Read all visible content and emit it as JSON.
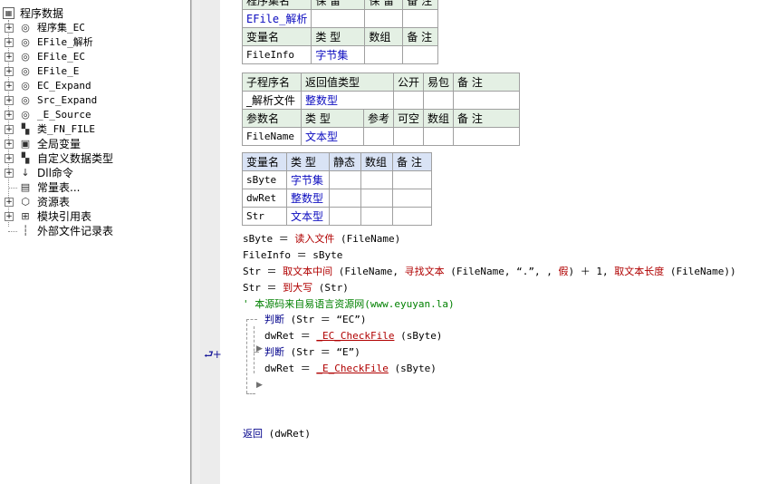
{
  "tree": {
    "root_label": "程序数据",
    "items": [
      {
        "label": "程序集_EC",
        "icon": "module-icon",
        "mono": true
      },
      {
        "label": "EFile_解析",
        "icon": "module-icon",
        "mono": true
      },
      {
        "label": "EFile_EC",
        "icon": "module-icon",
        "mono": true
      },
      {
        "label": "EFile_E",
        "icon": "module-icon",
        "mono": true
      },
      {
        "label": "EC_Expand",
        "icon": "module-icon",
        "mono": true
      },
      {
        "label": "Src_Expand",
        "icon": "module-icon",
        "mono": true
      },
      {
        "label": "_E_Source",
        "icon": "module-icon",
        "mono": true
      },
      {
        "label": "类_FN_FILE",
        "icon": "class-icon",
        "mono": true
      },
      {
        "label": "全局变量",
        "icon": "global-var-icon",
        "mono": false
      },
      {
        "label": "自定义数据类型",
        "icon": "datatype-icon",
        "mono": false
      },
      {
        "label": "Dll命令",
        "icon": "dll-icon",
        "mono": false
      },
      {
        "label": "常量表...",
        "icon": "constant-icon",
        "mono": false
      },
      {
        "label": "资源表",
        "icon": "resource-icon",
        "mono": false
      },
      {
        "label": "模块引用表",
        "icon": "module-ref-icon",
        "mono": false
      },
      {
        "label": "外部文件记录表",
        "icon": "external-file-icon",
        "mono": false
      }
    ]
  },
  "top_table": {
    "header": [
      "程序集名",
      "保 留",
      "保 留",
      "备 注"
    ],
    "name": "EFile_解析",
    "var_header": [
      "变量名",
      "类 型",
      "数组",
      "备 注"
    ],
    "var_row": [
      "FileInfo",
      "字节集",
      "",
      ""
    ]
  },
  "sub_table": {
    "header": [
      "子程序名",
      "返回值类型",
      "公开",
      "易包",
      "备 注"
    ],
    "row": [
      "_解析文件",
      "整数型",
      "",
      "",
      ""
    ],
    "param_header": [
      "参数名",
      "类 型",
      "参考",
      "可空",
      "数组",
      "备 注"
    ],
    "param_row": [
      "FileName",
      "文本型",
      "",
      "",
      "",
      ""
    ]
  },
  "local_table": {
    "header": [
      "变量名",
      "类 型",
      "静态",
      "数组",
      "备 注"
    ],
    "rows": [
      [
        "sByte",
        "字节集",
        "",
        "",
        ""
      ],
      [
        "dwRet",
        "整数型",
        "",
        "",
        ""
      ],
      [
        "Str",
        "文本型",
        "",
        "",
        ""
      ]
    ]
  },
  "code": {
    "line1": {
      "a": "sByte ＝ ",
      "kw": "读入文件",
      "b": " (FileName)"
    },
    "line2": {
      "a": "FileInfo ＝ sByte"
    },
    "line3": {
      "a": "Str ＝ ",
      "kw1": "取文本中间",
      "b": " (FileName, ",
      "kw2": "寻找文本",
      "c": " (FileName, “.”, , ",
      "kw3": "假",
      "d": ") ＋ 1, ",
      "kw4": "取文本长度",
      "e": " (FileName))"
    },
    "line4": {
      "a": "Str ＝ ",
      "kw": "到大写",
      "b": " (Str)"
    },
    "comment": "' 本源码来自易语言资源网(www.eyuyan.la)",
    "judge1": {
      "kw": "判断",
      "b": " (Str ＝ “EC”)"
    },
    "call1": {
      "a": "dwRet ＝ ",
      "fn": "_EC_CheckFile",
      "b": " (sByte)"
    },
    "judge2": {
      "kw": "判断",
      "b": " (Str ＝ “E”)"
    },
    "call2": {
      "a": "dwRet ＝ ",
      "fn": "_E_CheckFile",
      "b": " (sByte)"
    },
    "return": {
      "kw": "返回",
      "b": " (dwRet)"
    }
  },
  "gutter_icon": "⮐+"
}
